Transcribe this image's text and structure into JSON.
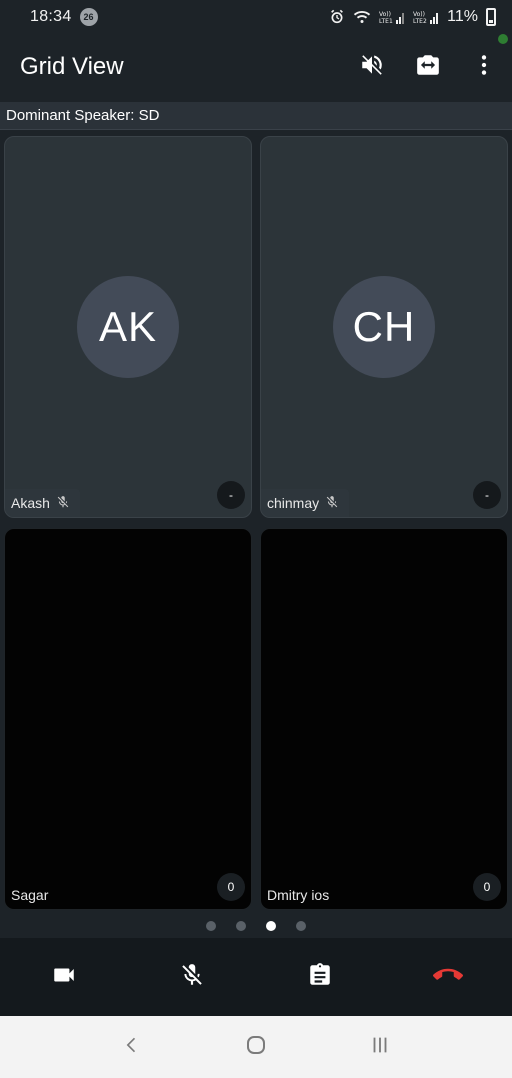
{
  "status_bar": {
    "time": "18:34",
    "notification_count": "26",
    "signal_label_1": "Vo))\nLTE1",
    "signal_label_2": "Vo))\nLTE2",
    "battery": "11%"
  },
  "app_bar": {
    "title": "Grid View",
    "icons": [
      "speaker-off-icon",
      "switch-camera-icon",
      "more-vert-icon"
    ]
  },
  "dominant_speaker": "Dominant Speaker: SD",
  "participants": [
    {
      "initials": "AK",
      "name": "Akash",
      "muted": true,
      "level": "-",
      "video": false
    },
    {
      "initials": "CH",
      "name": "chinmay",
      "muted": true,
      "level": "-",
      "video": false
    },
    {
      "initials": "",
      "name": "Sagar",
      "muted": false,
      "level": "0",
      "video": true
    },
    {
      "initials": "",
      "name": "Dmitry ios",
      "muted": false,
      "level": "0",
      "video": true
    }
  ],
  "pager": {
    "pages": 4,
    "active_index": 2
  },
  "controls": {
    "icons": [
      "video-camera-icon",
      "mic-off-icon",
      "clipboard-icon",
      "end-call-icon"
    ],
    "end_call_color": "#e53935"
  },
  "nav_bar": {
    "icons": [
      "back-icon",
      "home-icon",
      "recents-icon"
    ]
  },
  "colors": {
    "background": "#1d2328",
    "tile": "#2c3439",
    "avatar": "#434b58",
    "control_bar": "#14191d"
  }
}
